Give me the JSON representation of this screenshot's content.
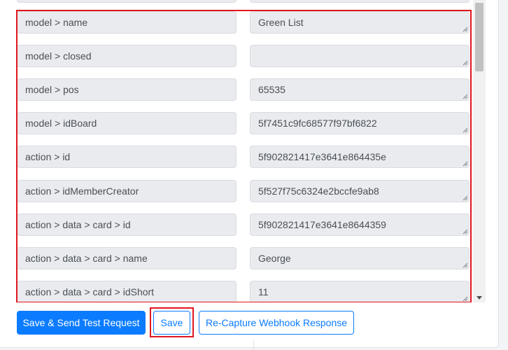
{
  "fields": [
    {
      "key": "model > name",
      "value": "Green List"
    },
    {
      "key": "model > closed",
      "value": ""
    },
    {
      "key": "model > pos",
      "value": "65535"
    },
    {
      "key": "model > idBoard",
      "value": "5f7451c9fc68577f97bf6822"
    },
    {
      "key": "action > id",
      "value": "5f902821417e3641e864435e"
    },
    {
      "key": "action > idMemberCreator",
      "value": "5f527f75c6324e2bccfe9ab8"
    },
    {
      "key": "action > data > card > id",
      "value": "5f902821417e3641e8644359"
    },
    {
      "key": "action > data > card > name",
      "value": "George"
    },
    {
      "key": "action > data > card > idShort",
      "value": "11"
    }
  ],
  "buttons": {
    "send_test": "Save & Send Test Request",
    "save": "Save",
    "recapture": "Re-Capture Webhook Response"
  },
  "colors": {
    "primary": "#0b7cff",
    "highlight": "#e0161e",
    "field_bg": "#e9ebee",
    "text": "#4a4f57"
  }
}
